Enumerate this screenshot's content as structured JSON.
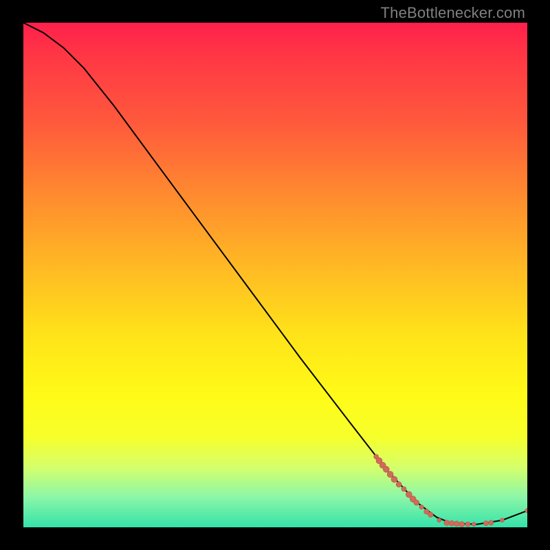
{
  "watermark": "TheBottlenecker.com",
  "colors": {
    "marker_fill": "#cf6b5a",
    "marker_stroke": "#b6584a",
    "curve_stroke": "#000000"
  },
  "chart_data": {
    "type": "line",
    "title": "",
    "xlabel": "",
    "ylabel": "",
    "xlim": [
      0,
      100
    ],
    "ylim": [
      0,
      100
    ],
    "curve": [
      {
        "x": 0,
        "y": 100
      },
      {
        "x": 4,
        "y": 98
      },
      {
        "x": 8,
        "y": 95
      },
      {
        "x": 12,
        "y": 91
      },
      {
        "x": 18,
        "y": 83.5
      },
      {
        "x": 25,
        "y": 74
      },
      {
        "x": 35,
        "y": 60.5
      },
      {
        "x": 45,
        "y": 47
      },
      {
        "x": 55,
        "y": 33.5
      },
      {
        "x": 65,
        "y": 20.5
      },
      {
        "x": 72,
        "y": 11.5
      },
      {
        "x": 78,
        "y": 5
      },
      {
        "x": 82,
        "y": 2
      },
      {
        "x": 85,
        "y": 0.8
      },
      {
        "x": 90,
        "y": 0.6
      },
      {
        "x": 95,
        "y": 1.4
      },
      {
        "x": 100,
        "y": 3.3
      }
    ],
    "markers": [
      {
        "x": 70.0,
        "y": 14.0,
        "r": 3.5
      },
      {
        "x": 70.6,
        "y": 13.2,
        "r": 4.5
      },
      {
        "x": 71.3,
        "y": 12.3,
        "r": 4.5
      },
      {
        "x": 72.0,
        "y": 11.5,
        "r": 4.5
      },
      {
        "x": 72.8,
        "y": 10.5,
        "r": 4.5
      },
      {
        "x": 73.6,
        "y": 9.5,
        "r": 4.5
      },
      {
        "x": 74.5,
        "y": 8.5,
        "r": 4.0
      },
      {
        "x": 75.5,
        "y": 7.6,
        "r": 3.6
      },
      {
        "x": 76.5,
        "y": 6.5,
        "r": 4.5
      },
      {
        "x": 77.3,
        "y": 5.6,
        "r": 4.5
      },
      {
        "x": 78.0,
        "y": 4.9,
        "r": 4.0
      },
      {
        "x": 79.0,
        "y": 4.0,
        "r": 3.2
      },
      {
        "x": 80.0,
        "y": 3.1,
        "r": 3.8
      },
      {
        "x": 80.8,
        "y": 2.5,
        "r": 3.8
      },
      {
        "x": 82.5,
        "y": 1.4,
        "r": 3.0
      },
      {
        "x": 84.0,
        "y": 0.9,
        "r": 4.0
      },
      {
        "x": 85.0,
        "y": 0.8,
        "r": 4.0
      },
      {
        "x": 86.0,
        "y": 0.7,
        "r": 4.0
      },
      {
        "x": 87.0,
        "y": 0.6,
        "r": 4.0
      },
      {
        "x": 88.2,
        "y": 0.6,
        "r": 3.6
      },
      {
        "x": 89.4,
        "y": 0.6,
        "r": 3.0
      },
      {
        "x": 91.8,
        "y": 0.8,
        "r": 3.6
      },
      {
        "x": 92.8,
        "y": 0.9,
        "r": 3.6
      },
      {
        "x": 95.0,
        "y": 1.4,
        "r": 3.0
      },
      {
        "x": 100.0,
        "y": 3.3,
        "r": 3.3
      }
    ]
  }
}
